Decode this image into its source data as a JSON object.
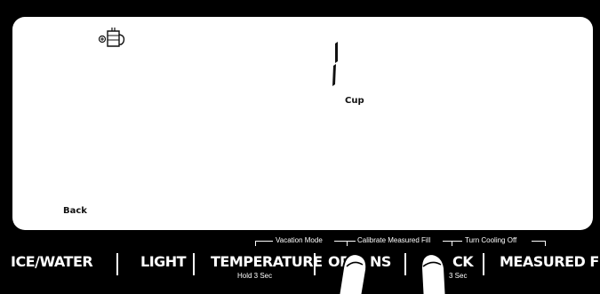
{
  "screen": {
    "display_value": "1",
    "unit": "Cup",
    "back_label": "Back"
  },
  "icons": {
    "pitcher": "measured-fill-pitcher-icon"
  },
  "hints": {
    "vacation_mode": "Vacation Mode",
    "calibrate": "Calibrate Measured Fill",
    "turn_cooling_off": "Turn Cooling Off"
  },
  "buttons": {
    "ice_water": "ICE/WATER",
    "light": "LIGHT",
    "temperature": "TEMPERATURE",
    "temperature_sub": "Hold 3 Sec",
    "options_left": "OP",
    "options_right": "NS",
    "lock_right": "CK",
    "lock_sub": "3 Sec",
    "measured_fill": "MEASURED FILL"
  },
  "colors": {
    "panel": "#000000",
    "screen": "#ffffff"
  }
}
